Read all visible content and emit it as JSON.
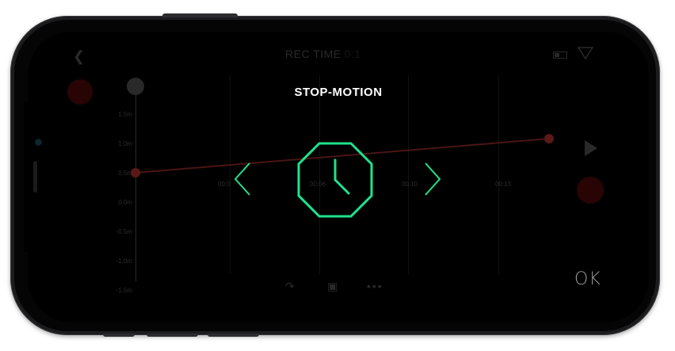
{
  "header": {
    "rec_time_label": "REC TIME",
    "rec_time_value": "0:1"
  },
  "graph": {
    "y_ticks": [
      "1.5m",
      "1.0m",
      "0.5m",
      "0.0m",
      "-0.5m",
      "-1.0m",
      "-1.5m"
    ],
    "x_ticks": [
      "00:0",
      "00:06",
      "00:10",
      "00:13"
    ]
  },
  "modal": {
    "title": "STOP-MOTION",
    "icon": "clock-octagon-icon",
    "prev_icon": "chevron-left-icon",
    "next_icon": "chevron-right-icon"
  },
  "actions": {
    "ok_label": "OK"
  },
  "colors": {
    "accent": "#1ee38c",
    "record": "#ff1a1a",
    "keyframe_line": "#4a1515"
  }
}
